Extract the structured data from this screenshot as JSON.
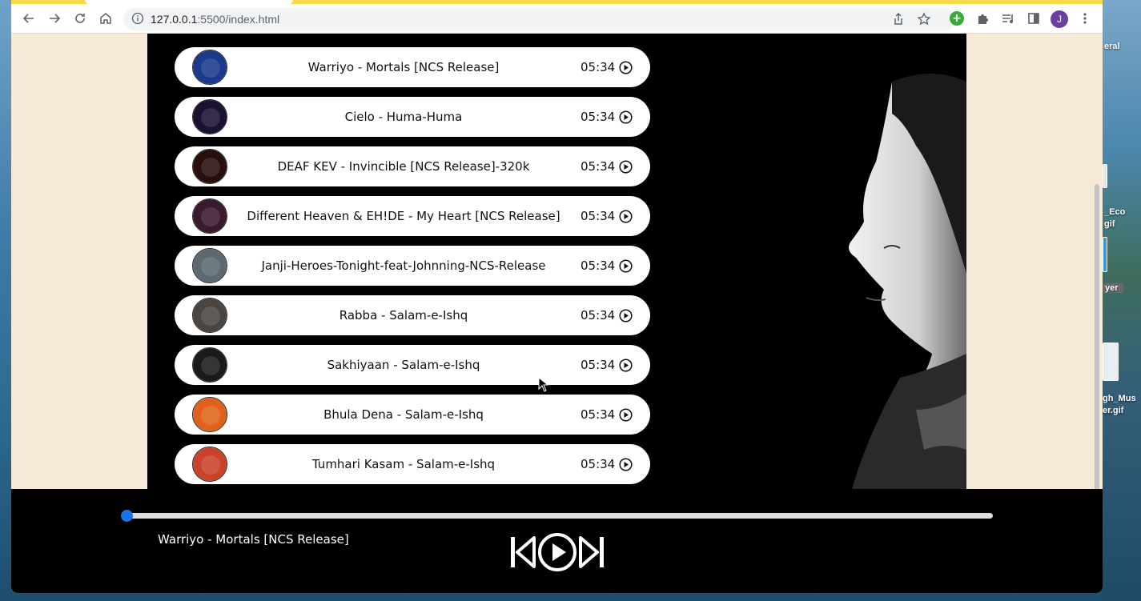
{
  "browser": {
    "url_host": "127.0.0.1",
    "url_rest": ":5500/index.html",
    "profile_initial": "J"
  },
  "desktop": {
    "labels": [
      "eral",
      "_Eco",
      "gif",
      "yer",
      "gh_Mus",
      "er.gif"
    ]
  },
  "playlist": [
    {
      "title": "Warriyo - Mortals [NCS Release]",
      "duration": "05:34",
      "thumb_color": "#1b3a8c"
    },
    {
      "title": "Cielo - Huma-Huma",
      "duration": "05:34",
      "thumb_color": "#1a1030"
    },
    {
      "title": "DEAF KEV - Invincible [NCS Release]-320k",
      "duration": "05:34",
      "thumb_color": "#2a0d0d"
    },
    {
      "title": "Different Heaven & EH!DE - My Heart [NCS Release]",
      "duration": "05:34",
      "thumb_color": "#3a1a2e"
    },
    {
      "title": "Janji-Heroes-Tonight-feat-Johnning-NCS-Release",
      "duration": "05:34",
      "thumb_color": "#5d6870"
    },
    {
      "title": "Rabba - Salam-e-Ishq",
      "duration": "05:34",
      "thumb_color": "#4a4540"
    },
    {
      "title": "Sakhiyaan - Salam-e-Ishq",
      "duration": "05:34",
      "thumb_color": "#1a1a1a"
    },
    {
      "title": "Bhula Dena - Salam-e-Ishq",
      "duration": "05:34",
      "thumb_color": "#e0621a"
    },
    {
      "title": "Tumhari Kasam - Salam-e-Ishq",
      "duration": "05:34",
      "thumb_color": "#c9422a"
    }
  ],
  "player": {
    "current_title": "Warriyo - Mortals [NCS Release]",
    "progress_percent": 0,
    "accent_color": "#1a73e8"
  },
  "icons": {
    "back": "arrow-left-icon",
    "forward": "arrow-right-icon",
    "reload": "reload-icon",
    "home": "home-icon",
    "share": "share-icon",
    "bookmark": "star-icon",
    "extensions": "puzzle-icon",
    "media": "media-queue-icon",
    "sidepanel": "side-panel-icon",
    "menu": "kebab-menu-icon",
    "prev": "skip-previous-icon",
    "play": "play-circle-icon",
    "next": "skip-next-icon"
  }
}
